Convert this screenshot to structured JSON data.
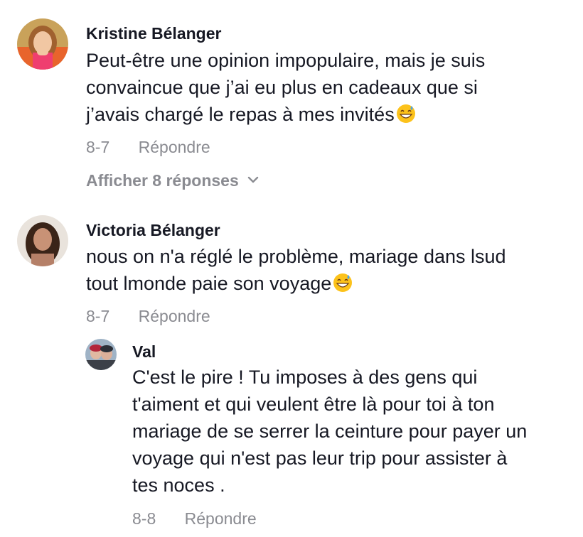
{
  "comments": [
    {
      "author": "Kristine Bélanger",
      "lines": [
        "Peut-être une opinion impopulaire, mais je suis",
        "convaincue que j’ai eu plus en cadeaux que si",
        "j’avais chargé le repas à mes invités"
      ],
      "emoji": "grinning-sweat-emoji",
      "date": "8-7",
      "reply_label": "Répondre",
      "view_replies_label": "Afficher 8 réponses"
    },
    {
      "author": "Victoria Bélanger",
      "lines": [
        "nous on n'a réglé le problème, mariage dans lsud",
        "tout lmonde paie son voyage"
      ],
      "emoji": "grinning-sweat-emoji",
      "date": "8-7",
      "reply_label": "Répondre"
    }
  ],
  "reply": {
    "author": "Val",
    "lines": [
      "C'est le pire ! Tu imposes à des gens qui",
      "t'aiment et qui veulent être là pour toi à ton",
      "mariage de se serrer la ceinture pour payer un",
      "voyage qui n'est pas leur trip pour assister à",
      "tes noces ."
    ],
    "date": "8-8",
    "reply_label": "Répondre"
  },
  "colors": {
    "text": "#161823",
    "muted": "#8a8b91",
    "background": "#ffffff"
  }
}
